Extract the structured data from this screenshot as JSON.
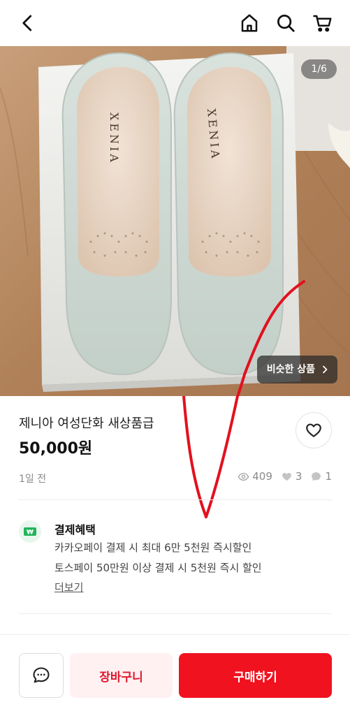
{
  "header": {
    "back_icon": "chevron-left-icon",
    "home_icon": "home-icon",
    "search_icon": "search-icon",
    "cart_icon": "cart-icon"
  },
  "gallery": {
    "counter": "1/6",
    "similar_label": "비슷한 상품",
    "insole_brand": "XENIA"
  },
  "product": {
    "title": "제니아 여성단화 새상품급",
    "price": "50,000원",
    "time_ago": "1일 전",
    "views": "409",
    "likes": "3",
    "chats": "1"
  },
  "benefits": {
    "title": "결제혜택",
    "lines": [
      "카카오페이 결제 시 최대 6만 5천원 즉시할인",
      "토스페이 50만원 이상 결제 시 5천원 즉시 할인"
    ],
    "more_label": "더보기"
  },
  "actions": {
    "cart_label": "장바구니",
    "buy_label": "구매하기"
  },
  "colors": {
    "accent": "#f0121f",
    "cart_bg": "#fff0f2",
    "cart_text": "#e0182d",
    "benefit_icon": "#22b35a"
  }
}
